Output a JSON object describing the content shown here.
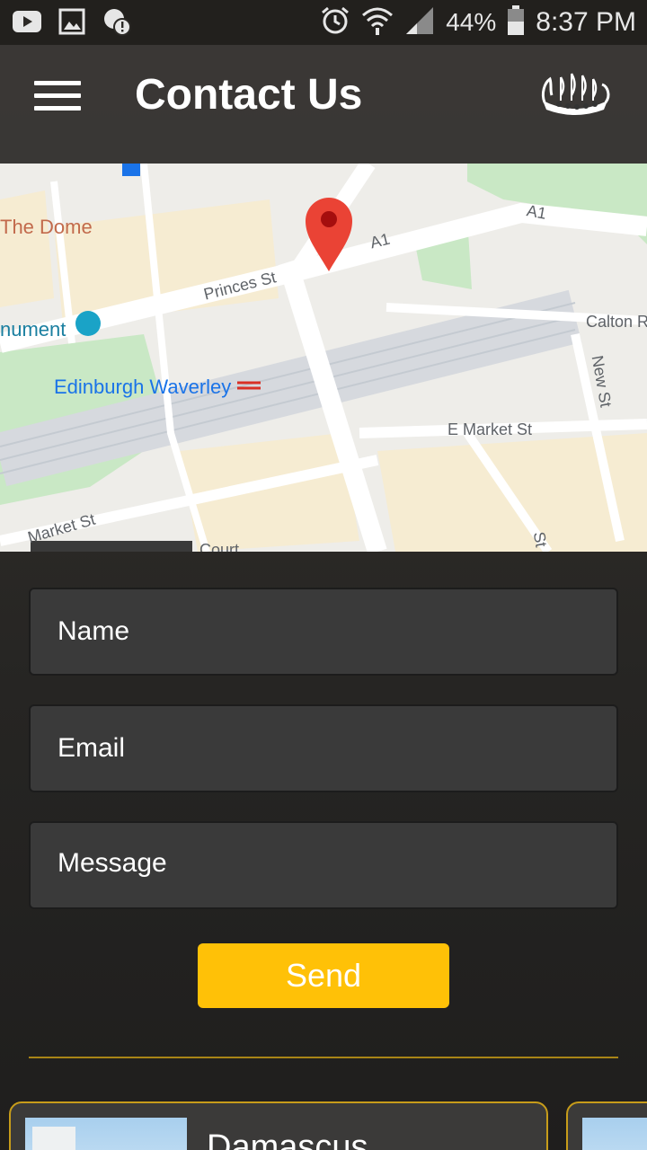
{
  "status_bar": {
    "battery": "44%",
    "time": "8:37 PM",
    "icons": [
      "youtube-icon",
      "gallery-icon",
      "alert-icon",
      "alarm-icon",
      "wifi-icon",
      "signal-icon",
      "battery-icon"
    ]
  },
  "header": {
    "title": "Contact Us",
    "menu_icon": "hamburger-menu-icon",
    "logo": "viking-ship-logo"
  },
  "map": {
    "labels": {
      "dome": "The Dome",
      "princes": "Princes St",
      "a1_right": "A1",
      "a1_mid": "A1",
      "calton": "Calton Ro",
      "monument": "nument",
      "waverley": "Edinburgh Waverley",
      "new_st": "New St",
      "market": "E Market St",
      "market_sw": "Market St",
      "court": "Court",
      "st": "St"
    },
    "pin_color": "#ea4335"
  },
  "form": {
    "name_placeholder": "Name",
    "email_placeholder": "Email",
    "message_placeholder": "Message",
    "send_label": "Send"
  },
  "locations": [
    {
      "title": "Damascus"
    },
    {
      "title": ""
    }
  ],
  "colors": {
    "accent": "#ffc107",
    "divider": "#a88516",
    "card_border": "#c79c1a"
  }
}
